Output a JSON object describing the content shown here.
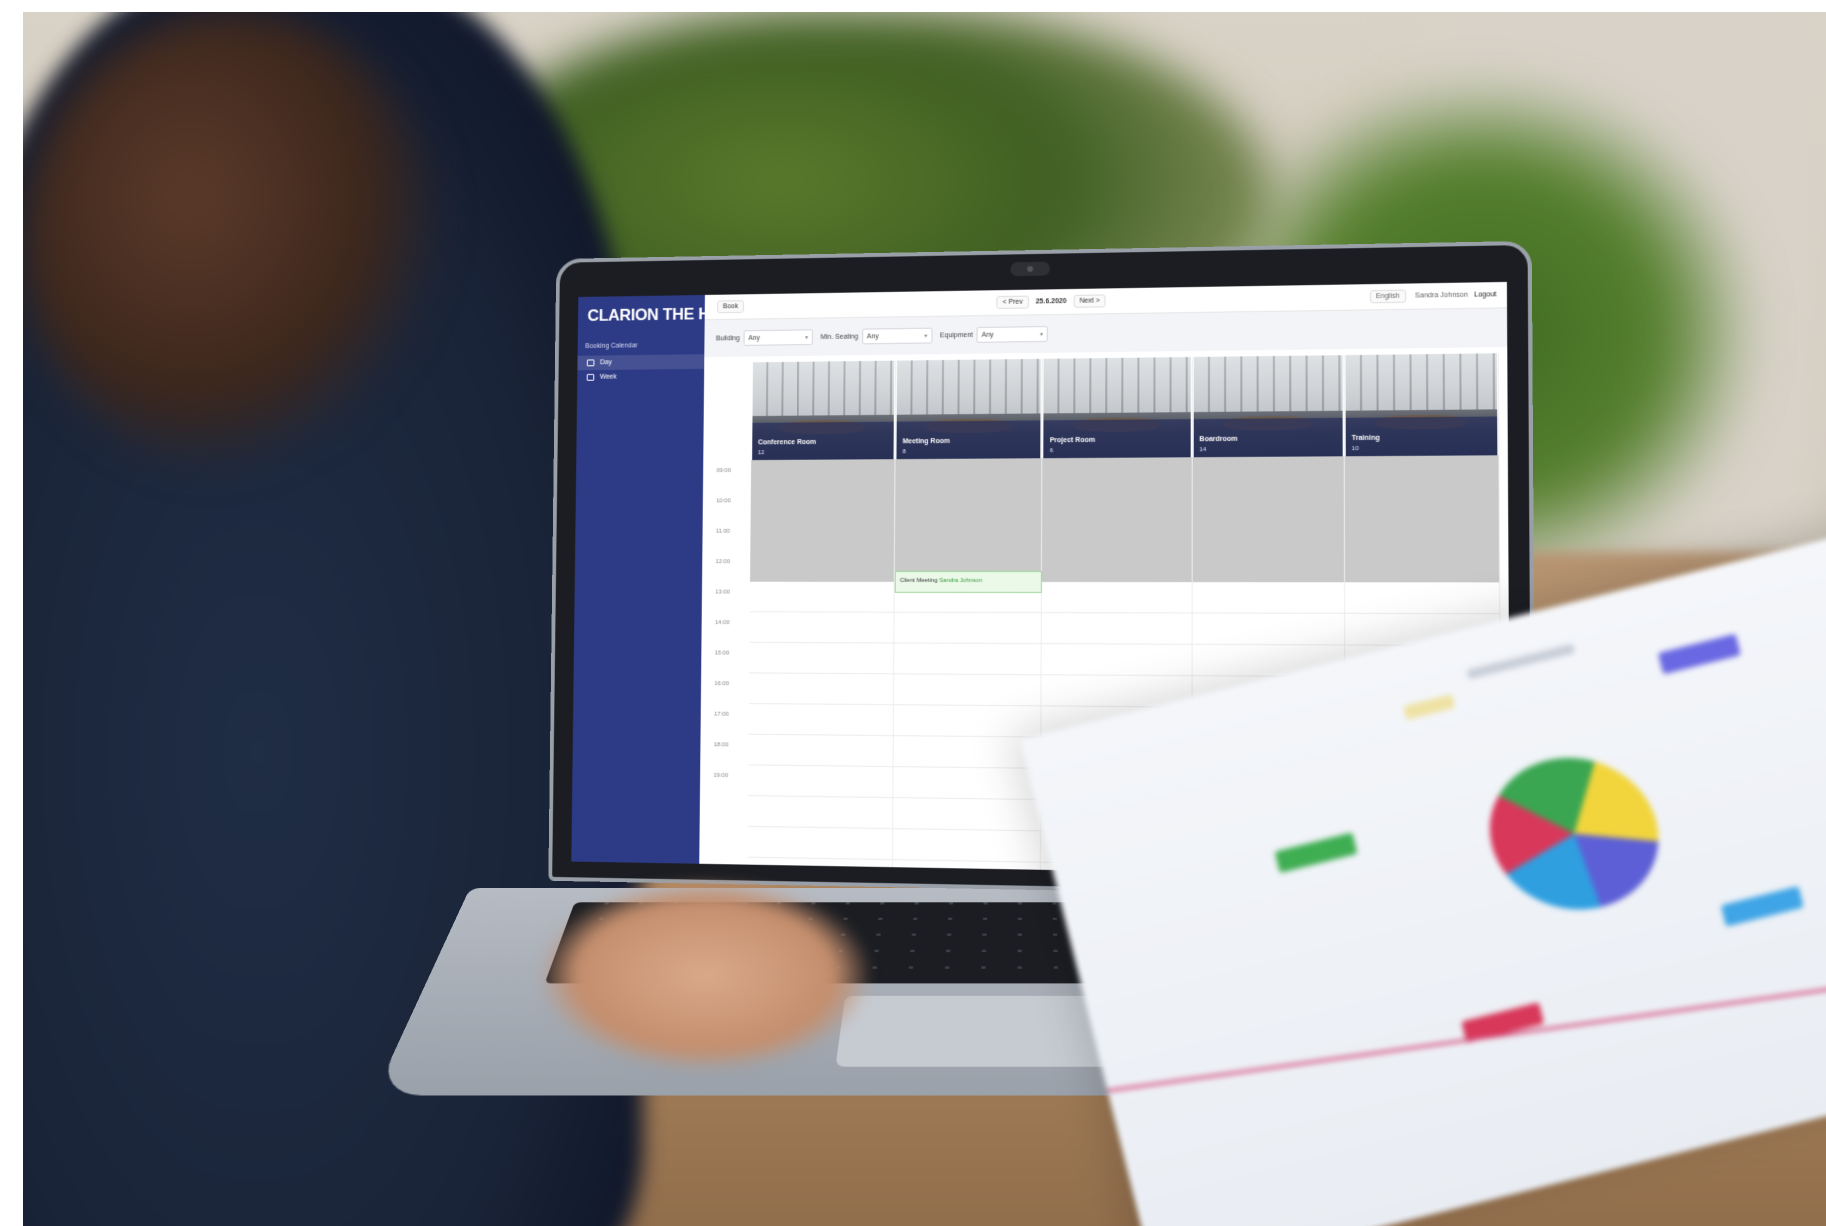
{
  "app": {
    "brand": "CLARION THE HUB"
  },
  "sidebar": {
    "section_label": "Booking Calendar",
    "items": [
      {
        "label": "Day",
        "active": true
      },
      {
        "label": "Week",
        "active": false
      }
    ]
  },
  "topbar": {
    "left_button": "Book",
    "prev_label": "< Prev",
    "date": "25.6.2020",
    "next_label": "Next >",
    "language": "English",
    "user": "Sandra Johnson",
    "logout": "Logout"
  },
  "filters": [
    {
      "label": "Building",
      "value": "Any"
    },
    {
      "label": "Min. Seating",
      "value": "Any"
    },
    {
      "label": "Equipment",
      "value": "Any"
    }
  ],
  "times": [
    "09:00",
    "10:00",
    "11:00",
    "12:00",
    "13:00",
    "14:00",
    "15:00",
    "16:00",
    "17:00",
    "18:00",
    "19:00"
  ],
  "rooms": [
    {
      "name": "Conference Room",
      "capacity": "12"
    },
    {
      "name": "Meeting Room",
      "capacity": "8"
    },
    {
      "name": "Project Room",
      "capacity": "6"
    },
    {
      "name": "Boardroom",
      "capacity": "14"
    },
    {
      "name": "Training",
      "capacity": "10"
    }
  ],
  "booking": {
    "title": "Client Meeting",
    "subtitle": "Sandra Johnson"
  },
  "colors": {
    "sidebar": "#2d3a86",
    "busy": "#c9c9c9",
    "booking_bg": "#eaf9e8",
    "booking_border": "#9fd79a"
  }
}
